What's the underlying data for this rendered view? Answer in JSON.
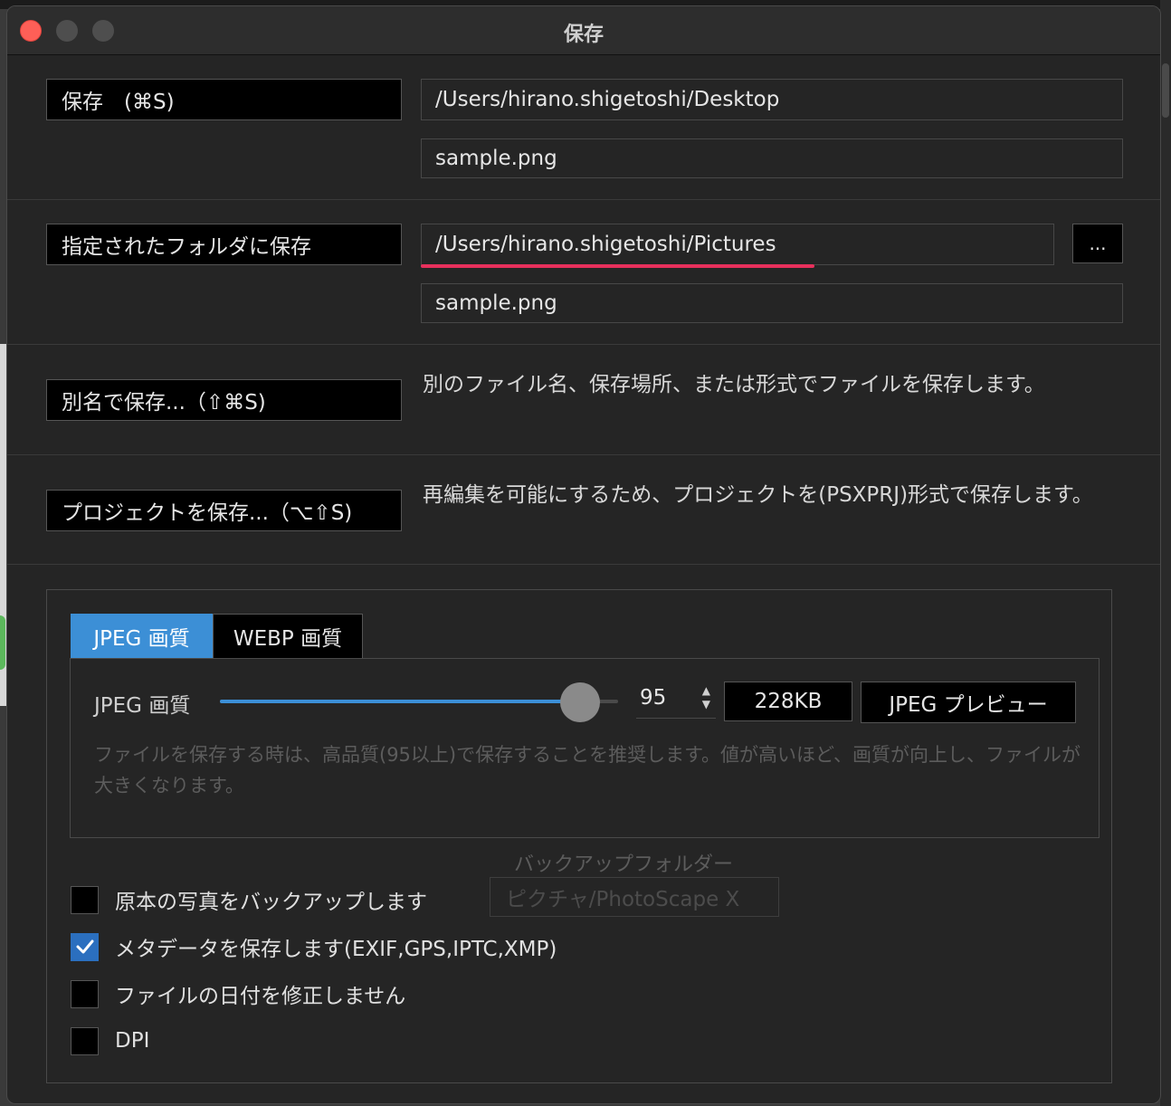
{
  "window": {
    "title": "保存"
  },
  "save": {
    "button_label": "保存　(⌘S)",
    "folder": "/Users/hirano.shigetoshi/Desktop",
    "filename": "sample.png"
  },
  "save_to_folder": {
    "button_label": "指定されたフォルダに保存",
    "folder": "/Users/hirano.shigetoshi/Pictures",
    "browse_label": "...",
    "filename": "sample.png"
  },
  "save_as": {
    "button_label": "別名で保存...（⇧⌘S)",
    "description": "別のファイル名、保存場所、または形式でファイルを保存します。"
  },
  "save_project": {
    "button_label": "プロジェクトを保存...（⌥⇧S)",
    "description": "再編集を可能にするため、プロジェクトを(PSXPRJ)形式で保存します。"
  },
  "quality": {
    "tabs": [
      {
        "label": "JPEG 画質",
        "active": true
      },
      {
        "label": "WEBP 画質",
        "active": false
      }
    ],
    "slider_label": "JPEG 画質",
    "slider_value_fraction": 0.9,
    "value": "95",
    "file_size": "228KB",
    "preview_label": "JPEG プレビュー",
    "hint": "ファイルを保存する時は、高品質(95以上)で保存することを推奨します。値が高いほど、画質が向上し、ファイルが大きくなります。"
  },
  "backup": {
    "label": "バックアップフォルダー",
    "folder": "ピクチャ/PhotoScape X"
  },
  "options": [
    {
      "label": "原本の写真をバックアップします",
      "checked": false
    },
    {
      "label": "メタデータを保存します(EXIF,GPS,IPTC,XMP)",
      "checked": true
    },
    {
      "label": "ファイルの日付を修正しません",
      "checked": false
    },
    {
      "label": "DPI",
      "checked": false
    }
  ],
  "colors": {
    "accent": "#3c8fd6",
    "underline": "#e8305c",
    "close": "#fe5f57"
  }
}
